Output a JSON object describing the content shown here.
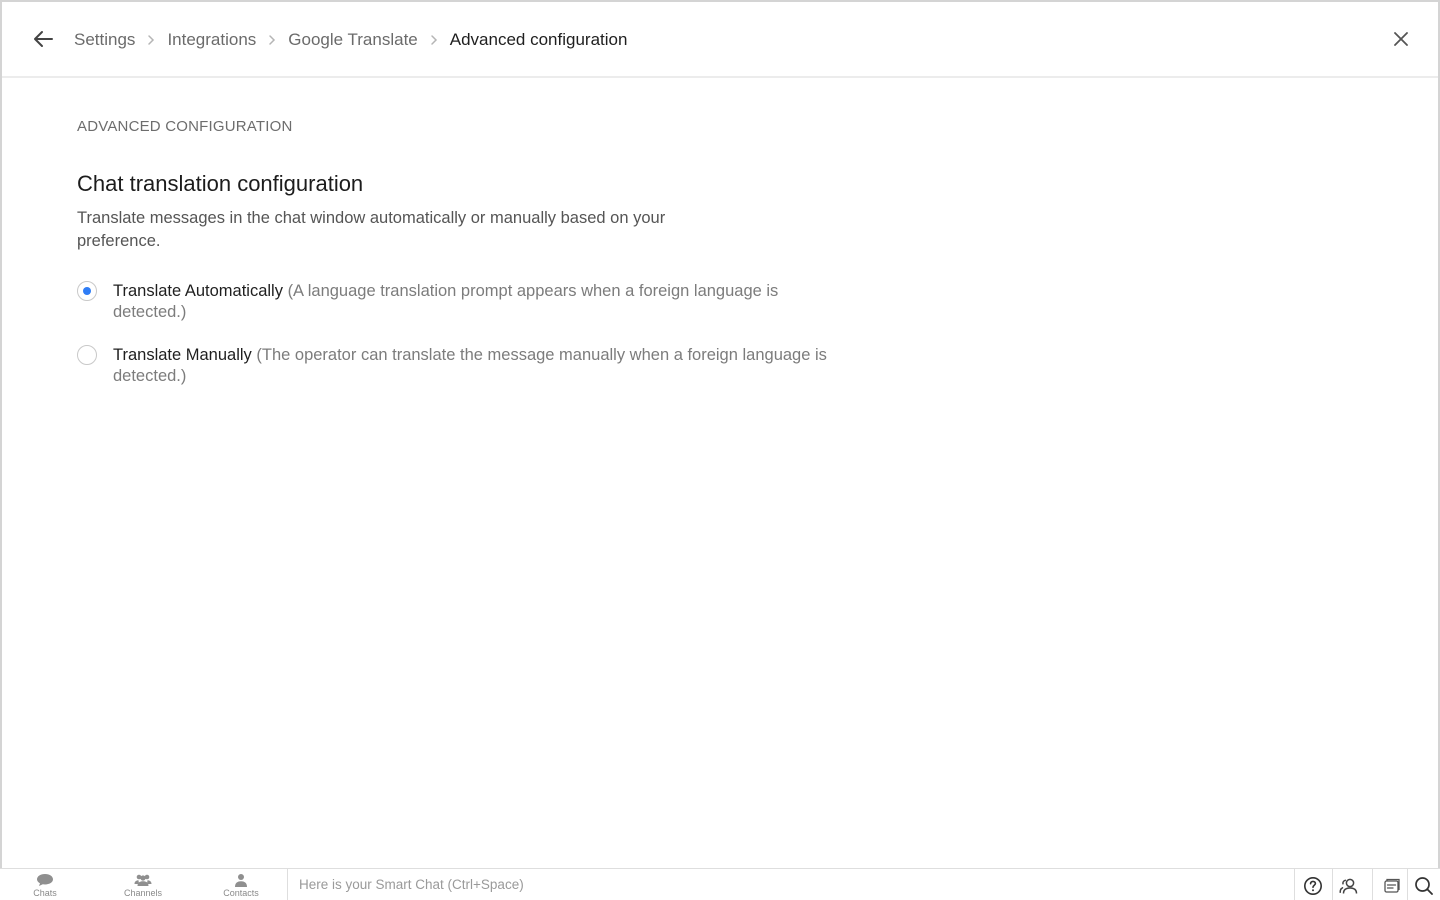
{
  "header": {
    "breadcrumb": [
      "Settings",
      "Integrations",
      "Google Translate",
      "Advanced configuration"
    ]
  },
  "main": {
    "section_label": "ADVANCED CONFIGURATION",
    "title": "Chat translation configuration",
    "description": "Translate messages in the chat window automatically or manually based on your preference.",
    "options": [
      {
        "label": "Translate Automatically",
        "hint": "(A language translation prompt appears when a foreign language is detected.)",
        "selected": true
      },
      {
        "label": "Translate Manually",
        "hint": "(The operator can translate the message manually when a foreign language is detected.)",
        "selected": false
      }
    ]
  },
  "bottombar": {
    "nav": [
      "Chats",
      "Channels",
      "Contacts"
    ],
    "smartchat_placeholder": "Here is your Smart Chat (Ctrl+Space)"
  },
  "colors": {
    "accent": "#2f7df6",
    "muted_text": "#6b6b6b",
    "border": "#dedede"
  }
}
